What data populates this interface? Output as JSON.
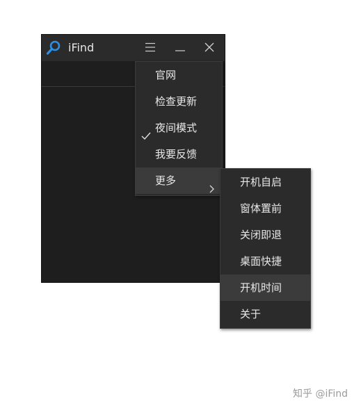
{
  "window": {
    "title": "iFind",
    "logo_icon": "search-icon",
    "controls": {
      "menu_icon": "hamburger-icon",
      "minimize_icon": "minimize-icon",
      "close_icon": "close-icon"
    }
  },
  "main_menu": {
    "items": [
      {
        "label": "官网"
      },
      {
        "label": "检查更新"
      },
      {
        "label": "夜间模式",
        "checked": true
      },
      {
        "label": "我要反馈"
      },
      {
        "label": "更多",
        "has_submenu": true,
        "highlighted": true
      }
    ]
  },
  "sub_menu": {
    "items": [
      {
        "label": "开机自启"
      },
      {
        "label": "窗体置前"
      },
      {
        "label": "关闭即退"
      },
      {
        "label": "桌面快捷"
      },
      {
        "label": "开机时间",
        "highlighted": true
      },
      {
        "label": "关于"
      }
    ]
  },
  "watermark": {
    "text": "知乎 @iFind"
  },
  "colors": {
    "accent": "#2f8fe0",
    "window_bg": "#1e1e1e",
    "titlebar_bg": "#2b2b2b",
    "menu_bg": "#2b2b2b",
    "highlight_bg": "#3b3b3b",
    "text": "#e8e8e8"
  }
}
